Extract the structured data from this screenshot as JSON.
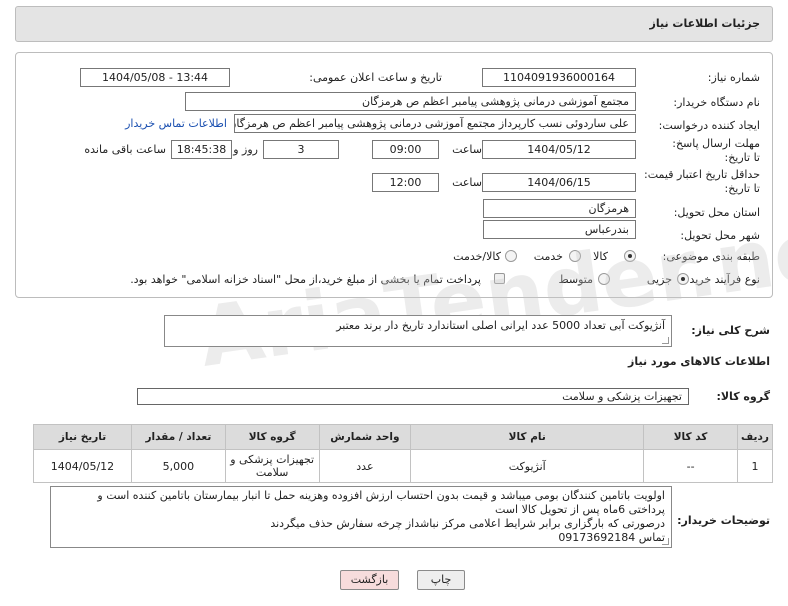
{
  "header": {
    "title": "جزئیات اطلاعات نیاز"
  },
  "form": {
    "need_number": {
      "label": "شماره نیاز:",
      "value": "1104091936000164"
    },
    "announce_datetime": {
      "label": "تاریخ و ساعت اعلان عمومی:",
      "value": "1404/05/08 - 13:44"
    },
    "buyer_org": {
      "label": "نام دستگاه خریدار:",
      "value": "مجتمع آموزشی درمانی پژوهشی پیامبر اعظم ص  هرمزگان"
    },
    "requester": {
      "label": "ایجاد کننده درخواست:",
      "value": "علی سارد‌وئی نسب کارپرداز مجتمع آموزشی درمانی پژوهشی پیامبر اعظم ص  هرمزگان"
    },
    "buyer_contact_link": "اطلاعات تماس خریدار",
    "reply_deadline": {
      "label": "مهلت ارسال پاسخ: تا تاریخ:",
      "date": "1404/05/12",
      "time_label": "ساعت",
      "time": "09:00",
      "days": "3",
      "days_label": "روز و",
      "remaining": "18:45:38",
      "remaining_label": "ساعت باقی مانده"
    },
    "price_validity": {
      "label": "حداقل تاریخ اعتبار قیمت: تا تاریخ:",
      "date": "1404/06/15",
      "time_label": "ساعت",
      "time": "12:00"
    },
    "delivery_province": {
      "label": "استان محل تحویل:",
      "value": "هرمزگان"
    },
    "delivery_city": {
      "label": "شهر محل تحویل:",
      "value": "بندرعباس"
    },
    "category": {
      "label": "طبقه بندی موضوعی:",
      "options": [
        "کالا",
        "خدمت",
        "کالا/خدمت"
      ],
      "selected": "کالا"
    },
    "purchase_process": {
      "label": "نوع فرآیند خرید :",
      "options": [
        "جزیی",
        "متوسط"
      ],
      "selected": "جزیی",
      "treasury_note": "پرداخت تمام یا بخشی از مبلغ خرید،از محل \"اسناد خزانه اسلامی\" خواهد بود."
    }
  },
  "summary": {
    "label": "شرح کلی نیاز:",
    "value": "آنژیوکت آبی تعداد 5000 عدد ایرانی اصلی استاندارد تاریخ دار برند معتبر"
  },
  "goods_section": {
    "title": "اطلاعات کالاهای مورد نیاز"
  },
  "goods_group": {
    "label": "گروه کالا:",
    "value": "تجهیزات پزشکی و سلامت"
  },
  "table": {
    "headers": [
      "ردیف",
      "کد کالا",
      "نام کالا",
      "واحد شمارش",
      "گروه کالا",
      "تعداد / مقدار",
      "تاریخ نیاز"
    ],
    "rows": [
      {
        "index": "1",
        "code": "--",
        "name": "آنژیوکت",
        "unit": "عدد",
        "group": "تجهیزات پزشکی و سلامت",
        "qty": "5,000",
        "date": "1404/05/12"
      }
    ]
  },
  "buyer_notes": {
    "label": "توضیحات خریدار:",
    "lines": [
      "اولویت باتامین کنندگان بومی میباشد و قیمت بدون احتساب ارزش افزوده وهزینه حمل تا انبار بیمارستان باتامین کننده است و",
      "پرداختی 6ماه پس از تحویل کالا است",
      "درصورتی که بارگزاری برابر شرایط اعلامی مرکز نباشداز چرخه سفارش حذف میگردند",
      "تماس 09173692184"
    ]
  },
  "buttons": {
    "print": "چاپ",
    "back": "بازگشت"
  },
  "watermark": "AriaTender.neT",
  "colors": {
    "link": "#1a4fb0",
    "back_button": "#f7dcdc",
    "print_button": "#eeeeee",
    "header_bg": "#e4e4e4"
  }
}
